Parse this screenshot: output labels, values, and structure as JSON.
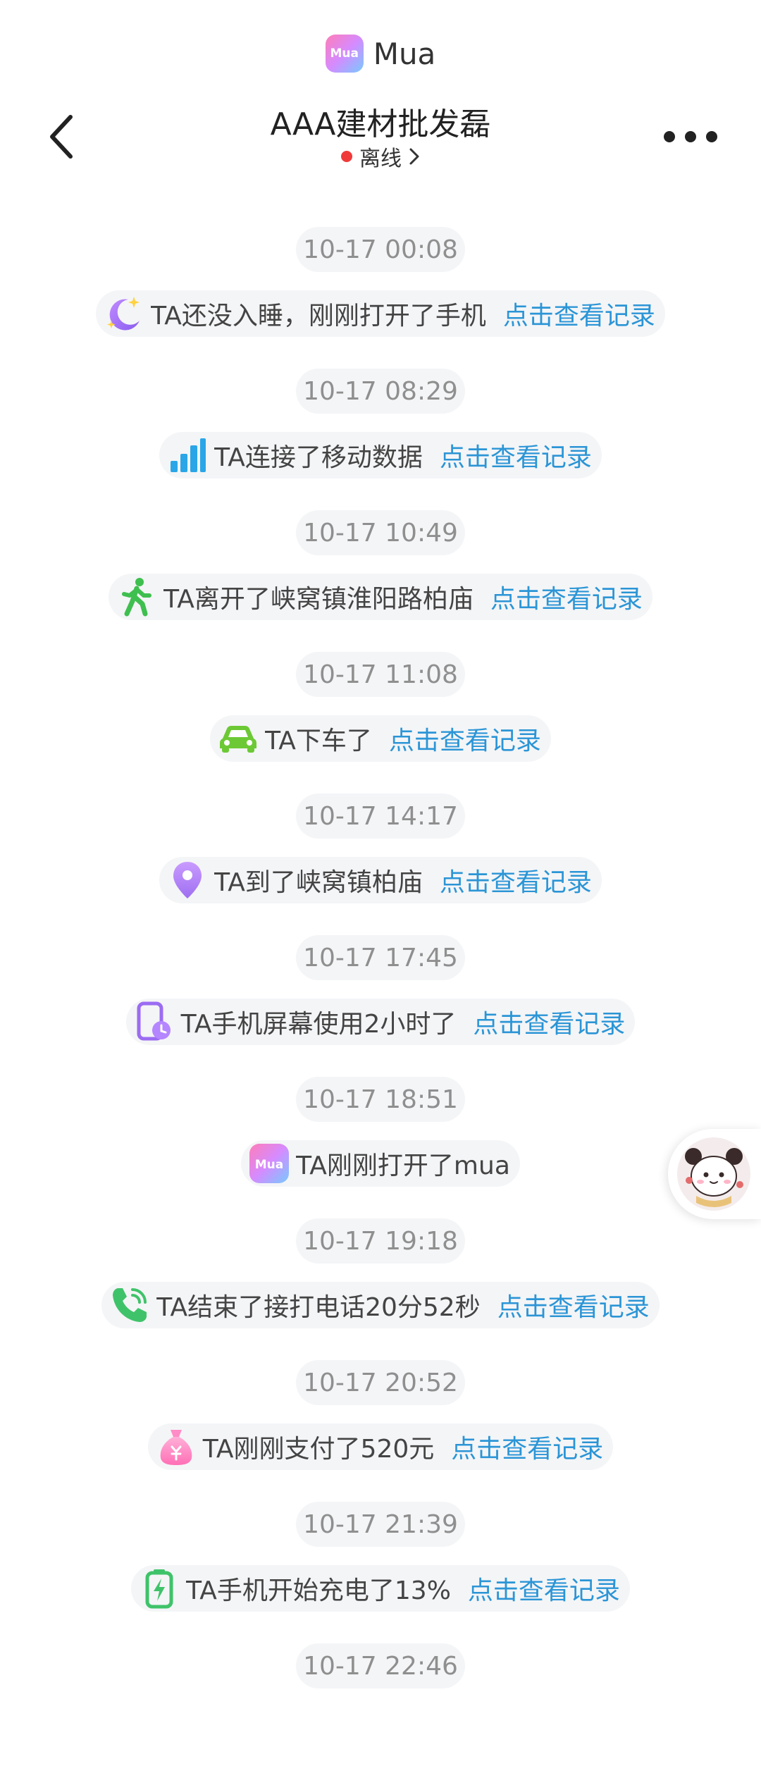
{
  "brand": {
    "logo_text": "Mua",
    "name": "Mua"
  },
  "header": {
    "contact_name": "AAA建材批发磊",
    "status": "离线",
    "status_color": "#f03a3a"
  },
  "colors": {
    "link": "#2b95d6",
    "pill_bg": "#f4f5f7",
    "time_text": "#8f8f8f"
  },
  "feed": [
    {
      "time": "10-17 00:08",
      "icon": "moon-star-icon",
      "text": "TA还没入睡，刚刚打开了手机",
      "link": "点击查看记录"
    },
    {
      "time": "10-17 08:29",
      "icon": "signal-bars-icon",
      "text": "TA连接了移动数据",
      "link": "点击查看记录"
    },
    {
      "time": "10-17 10:49",
      "icon": "walking-person-icon",
      "text": "TA离开了峡窝镇淮阳路柏庙",
      "link": "点击查看记录"
    },
    {
      "time": "10-17 11:08",
      "icon": "car-icon",
      "text": "TA下车了",
      "link": "点击查看记录"
    },
    {
      "time": "10-17 14:17",
      "icon": "location-pin-icon",
      "text": "TA到了峡窝镇柏庙",
      "link": "点击查看记录"
    },
    {
      "time": "10-17 17:45",
      "icon": "phone-clock-icon",
      "text": "TA手机屏幕使用2小时了",
      "link": "点击查看记录"
    },
    {
      "time": "10-17 18:51",
      "icon": "mua-logo-icon",
      "text": "TA刚刚打开了mua",
      "link": ""
    },
    {
      "time": "10-17 19:18",
      "icon": "phone-call-icon",
      "text": "TA结束了接打电话20分52秒",
      "link": "点击查看记录"
    },
    {
      "time": "10-17 20:52",
      "icon": "money-bag-icon",
      "text": "TA刚刚支付了520元",
      "link": "点击查看记录"
    },
    {
      "time": "10-17 21:39",
      "icon": "battery-charging-icon",
      "text": "TA手机开始充电了13%",
      "link": "点击查看记录"
    },
    {
      "time": "10-17 22:46",
      "icon": "",
      "text": "",
      "link": ""
    }
  ]
}
